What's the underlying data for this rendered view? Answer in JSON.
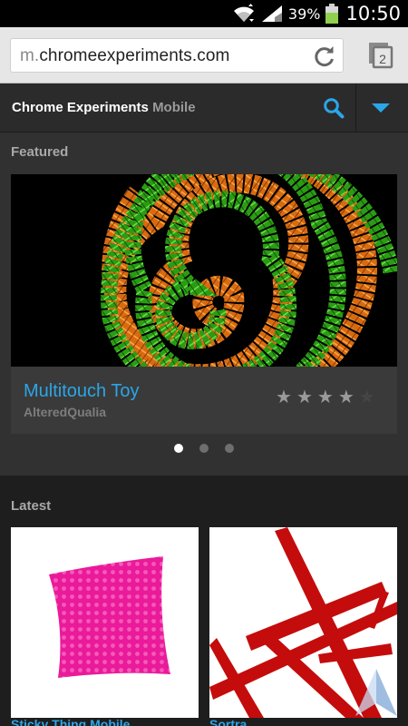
{
  "status_bar": {
    "battery_pct": "39%",
    "time": "10:50",
    "icons": [
      "wifi-icon",
      "signal-icon",
      "battery-icon"
    ]
  },
  "browser": {
    "url_scheme": "m.",
    "url_host": "chromeexperiments.com",
    "tab_count": "2"
  },
  "header": {
    "title": "Chrome Experiments",
    "title_suffix": "Mobile"
  },
  "featured": {
    "section_label": "Featured",
    "title": "Multitouch Toy",
    "author": "AlteredQualia",
    "rating": 4,
    "rating_max": 5,
    "star_glyph": "★",
    "page_count": 3,
    "active_page": 0
  },
  "latest": {
    "section_label": "Latest",
    "items": [
      {
        "title": "Sticky Thing Mobile"
      },
      {
        "title": "Sortra"
      }
    ]
  },
  "colors": {
    "accent": "#2ba6e8",
    "header_bg": "#2b2b2b",
    "section_bg": "#313131"
  }
}
